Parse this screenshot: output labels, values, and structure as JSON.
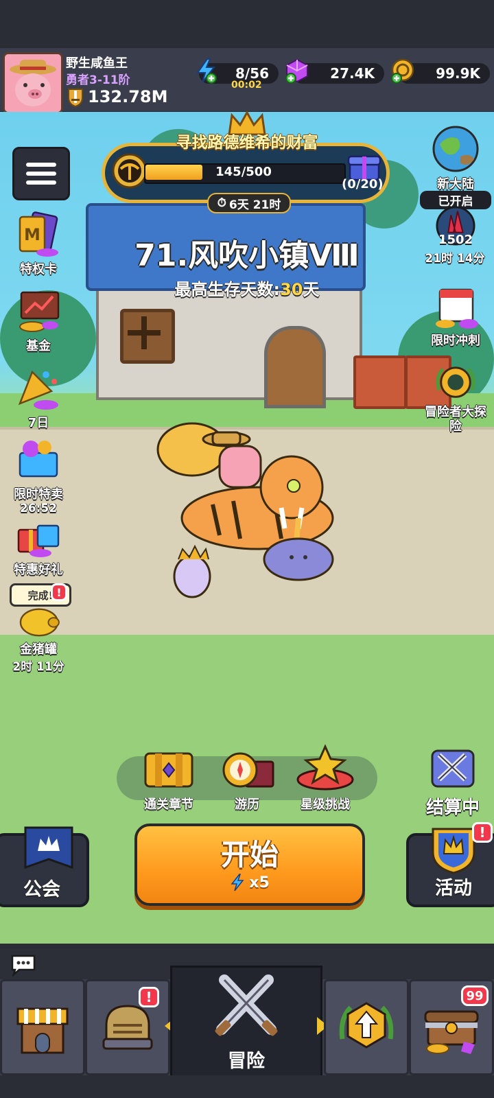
{
  "player": {
    "name": "野生咸鱼王",
    "rank": "勇者3-11阶",
    "power": "132.78M"
  },
  "resources": {
    "energy": {
      "value": "8/56",
      "timer": "00:02",
      "icon": "lightning-icon"
    },
    "gems": {
      "value": "27.4K",
      "icon": "purple-gem-icon"
    },
    "gold": {
      "value": "99.9K",
      "icon": "gold-coin-icon"
    }
  },
  "quest": {
    "title": "寻找路德维希的财富",
    "progress_text": "145/500",
    "progress_fraction": 0.29,
    "reward_count": "(0/20)",
    "timer": "6天 21时"
  },
  "stage": {
    "title": "71.风吹小镇Ⅷ",
    "survive_label": "最高生存天数:",
    "survive_value": "30",
    "survive_unit": "天"
  },
  "left_menu": [
    {
      "label": "特权卡"
    },
    {
      "label": "基金"
    },
    {
      "label": "7日"
    },
    {
      "label": "限时特卖",
      "sub": "26:52"
    },
    {
      "label": "特惠好礼"
    },
    {
      "label": "金猪罐",
      "sub": "2时 11分",
      "bubble": "完成!"
    }
  ],
  "right_menu": {
    "continent": {
      "label": "新大陆",
      "status": "已开启"
    },
    "crystal": {
      "count": "1502",
      "timer": "21时 14分"
    },
    "sprint": {
      "label": "限时冲刺"
    },
    "explore": {
      "label": "冒险者大探险"
    }
  },
  "tray": {
    "chapter": "通关章节",
    "travel": "游历",
    "star": "星级挑战"
  },
  "settle": {
    "label": "结算中"
  },
  "start": {
    "label": "开始",
    "cost": "x5"
  },
  "guild": {
    "label": "公会"
  },
  "activity": {
    "label": "活动",
    "badge": "!"
  },
  "nav": {
    "adventure": "冒险",
    "chest_badge": "99",
    "armor_badge": "!"
  },
  "colors": {
    "start_orange": "#ff9a1e",
    "gold_frame": "#e7b43a",
    "badge_red": "#f2384a",
    "rank_purple": "#d9a2ff"
  }
}
